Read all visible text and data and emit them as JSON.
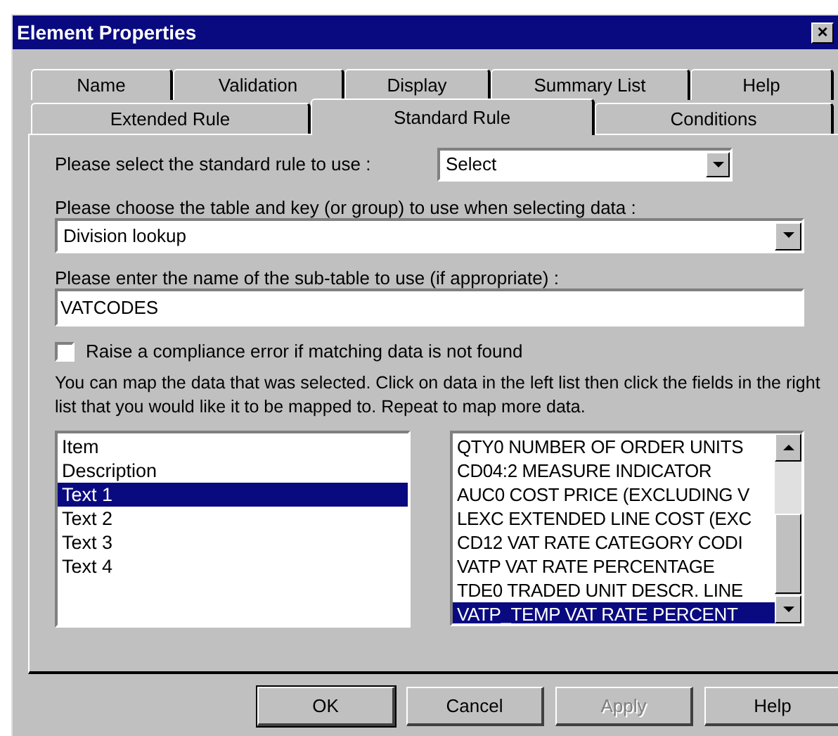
{
  "window": {
    "title": "Element Properties",
    "close": "×"
  },
  "tab_rows": [
    [
      {
        "label": "Name",
        "selected": false
      },
      {
        "label": "Validation",
        "selected": false
      },
      {
        "label": "Display",
        "selected": false
      },
      {
        "label": "Summary List",
        "selected": false
      },
      {
        "label": "Help",
        "selected": false
      }
    ],
    [
      {
        "label": "Extended Rule",
        "selected": false
      },
      {
        "label": "Standard Rule",
        "selected": true
      },
      {
        "label": "Conditions",
        "selected": false
      }
    ]
  ],
  "rule": {
    "label": "Please select the standard rule to use :",
    "value": "Select"
  },
  "table": {
    "label": "Please choose the table and key (or group) to use when selecting data :",
    "value": "Division lookup"
  },
  "subtable": {
    "label": "Please enter the name of the sub-table to use (if appropriate) :",
    "value": "VATCODES"
  },
  "compliance": {
    "label": "Raise a compliance error if matching data is not found",
    "checked": false
  },
  "instructions": "You can map the data that was selected. Click on data in the left list then click the fields in the right list that you would like it to be mapped to. Repeat to map more data.",
  "source_list": [
    {
      "label": "Item",
      "selected": false
    },
    {
      "label": "Description",
      "selected": false
    },
    {
      "label": "Text 1",
      "selected": true
    },
    {
      "label": "Text 2",
      "selected": false
    },
    {
      "label": "Text 3",
      "selected": false
    },
    {
      "label": "Text 4",
      "selected": false
    }
  ],
  "target_list": [
    {
      "label": "QTY0 NUMBER OF ORDER UNITS",
      "selected": false
    },
    {
      "label": "CD04:2 MEASURE INDICATOR",
      "selected": false
    },
    {
      "label": "AUC0 COST PRICE (EXCLUDING V",
      "selected": false
    },
    {
      "label": "LEXC EXTENDED LINE COST (EXC",
      "selected": false
    },
    {
      "label": "CD12 VAT RATE CATEGORY CODI",
      "selected": false
    },
    {
      "label": "VATP VAT RATE PERCENTAGE",
      "selected": false
    },
    {
      "label": "TDE0 TRADED UNIT DESCR. LINE",
      "selected": false
    },
    {
      "label": "VATP_TEMP VAT RATE PERCENT",
      "selected": true
    }
  ],
  "buttons": [
    {
      "label": "OK",
      "disabled": false
    },
    {
      "label": "Cancel",
      "disabled": false
    },
    {
      "label": "Apply",
      "disabled": true
    },
    {
      "label": "Help",
      "disabled": false
    }
  ]
}
